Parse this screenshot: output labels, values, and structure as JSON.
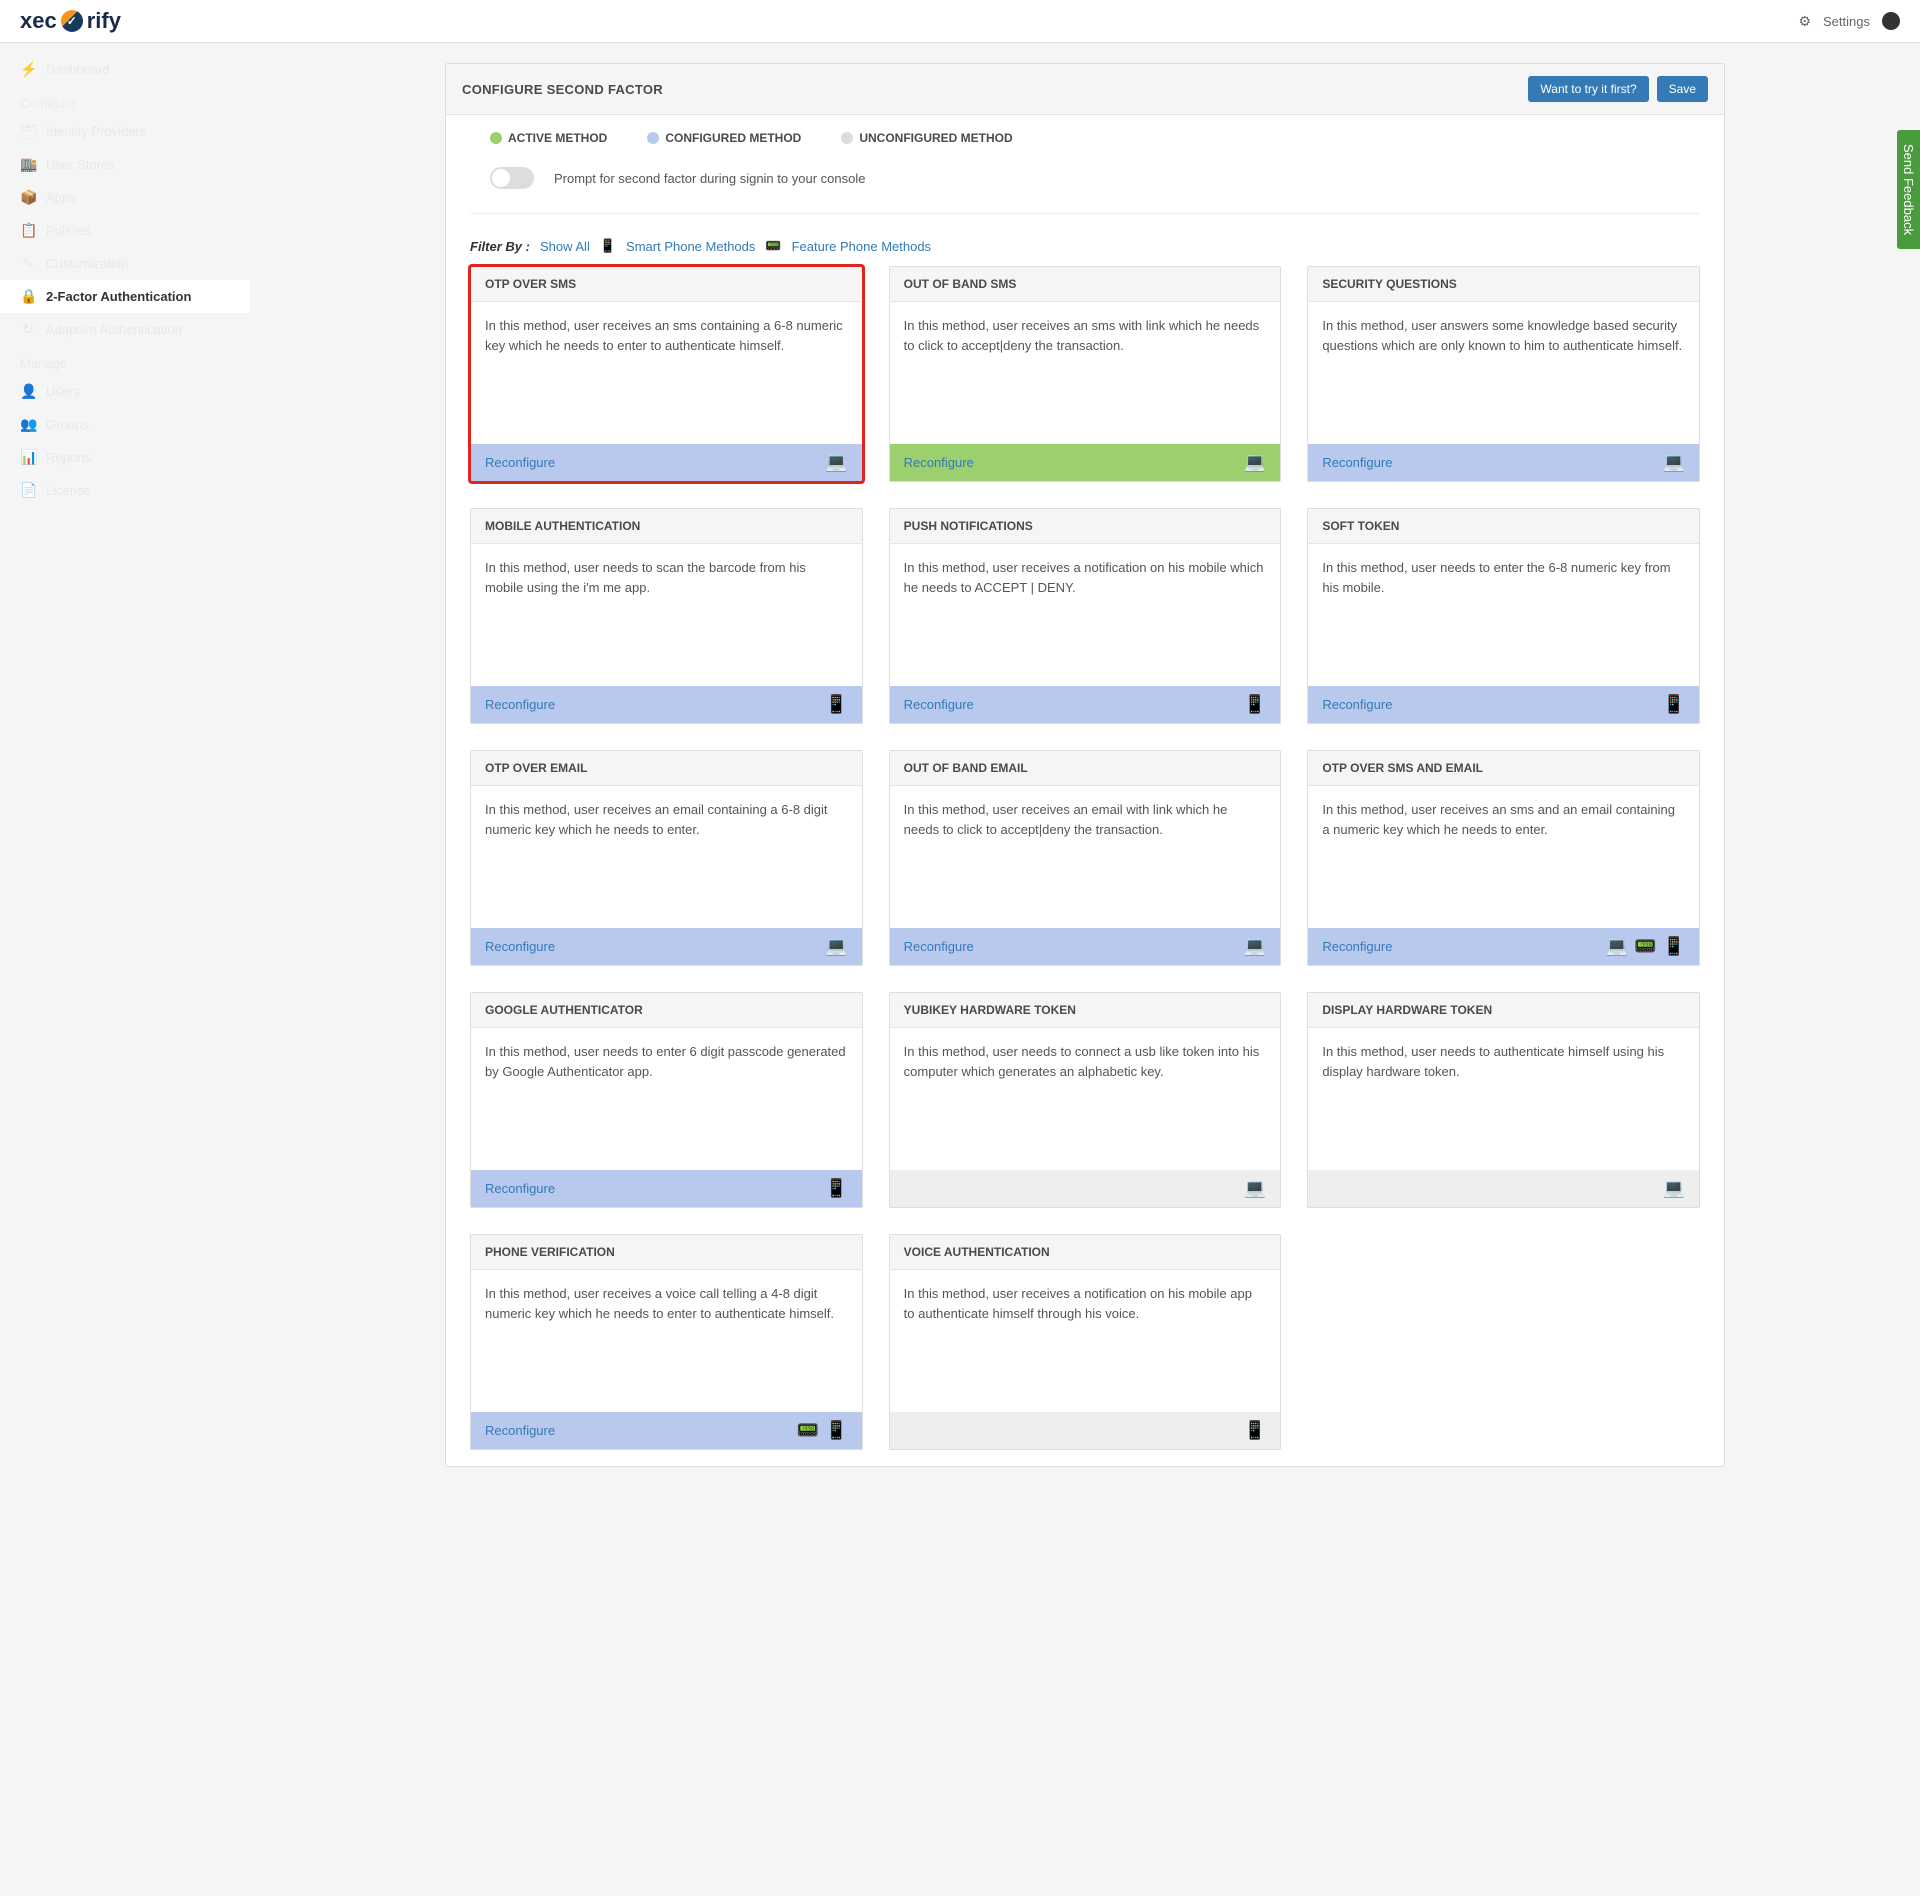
{
  "top": {
    "settings": "Settings"
  },
  "feedback": "Send Feedback",
  "nav": {
    "configure": "Configure",
    "manage": "Manage",
    "items": [
      {
        "icon": "⚡",
        "label": "Dashboard"
      },
      {
        "icon": "🗂",
        "label": "Identity Providers"
      },
      {
        "icon": "🏬",
        "label": "User Stores"
      },
      {
        "icon": "📦",
        "label": "Apps"
      },
      {
        "icon": "📋",
        "label": "Policies"
      },
      {
        "icon": "✎",
        "label": "Customization"
      },
      {
        "icon": "🔒",
        "label": "2-Factor Authentication",
        "active": true
      },
      {
        "icon": "↻",
        "label": "Adaptive Authentication"
      },
      {
        "icon": "👤",
        "label": "Users"
      },
      {
        "icon": "👥",
        "label": "Groups"
      },
      {
        "icon": "📊",
        "label": "Reports"
      },
      {
        "icon": "📄",
        "label": "License"
      }
    ]
  },
  "panel": {
    "title": "CONFIGURE SECOND FACTOR",
    "try": "Want to try it first?",
    "save": "Save",
    "legend": {
      "active": "ACTIVE METHOD",
      "configured": "CONFIGURED METHOD",
      "unconfigured": "UNCONFIGURED METHOD"
    },
    "prompt": "Prompt for second factor during signin to your console",
    "filter": {
      "label": "Filter By :",
      "all": "Show All",
      "smart": "Smart Phone Methods",
      "feature": "Feature Phone Methods"
    }
  },
  "reconfigure": "Reconfigure",
  "cards": [
    {
      "title": "OTP OVER SMS",
      "desc": "In this method, user receives an sms containing a 6-8 numeric key which he needs to enter to authenticate himself.",
      "status": "configured",
      "action": true,
      "icons": [
        "💻"
      ],
      "highlight": true
    },
    {
      "title": "OUT OF BAND SMS",
      "desc": "In this method, user receives an sms with link which he needs to click to accept|deny the transaction.",
      "status": "active",
      "action": true,
      "icons": [
        "💻"
      ]
    },
    {
      "title": "SECURITY QUESTIONS",
      "desc": "In this method, user answers some knowledge based security questions which are only known to him to authenticate himself.",
      "status": "configured",
      "action": true,
      "icons": [
        "💻"
      ]
    },
    {
      "title": "MOBILE AUTHENTICATION",
      "desc": "In this method, user needs to scan the barcode from his mobile using the i'm me app.",
      "status": "configured",
      "action": true,
      "icons": [
        "📱"
      ]
    },
    {
      "title": "PUSH NOTIFICATIONS",
      "desc": "In this method, user receives a notification on his mobile which he needs to ACCEPT | DENY.",
      "status": "configured",
      "action": true,
      "icons": [
        "📱"
      ]
    },
    {
      "title": "SOFT TOKEN",
      "desc": "In this method, user needs to enter the 6-8 numeric key from his mobile.",
      "status": "configured",
      "action": true,
      "icons": [
        "📱"
      ]
    },
    {
      "title": "OTP OVER EMAIL",
      "desc": "In this method, user receives an email containing a 6-8 digit numeric key which he needs to enter.",
      "status": "configured",
      "action": true,
      "icons": [
        "💻"
      ]
    },
    {
      "title": "OUT OF BAND EMAIL",
      "desc": "In this method, user receives an email with link which he needs to click to accept|deny the transaction.",
      "status": "configured",
      "action": true,
      "icons": [
        "💻"
      ]
    },
    {
      "title": "OTP OVER SMS AND EMAIL",
      "desc": "In this method, user receives an sms and an email containing a numeric key which he needs to enter.",
      "status": "configured",
      "action": true,
      "icons": [
        "💻",
        "📟",
        "📱"
      ]
    },
    {
      "title": "GOOGLE AUTHENTICATOR",
      "desc": "In this method, user needs to enter 6 digit passcode generated by Google Authenticator app.",
      "status": "configured",
      "action": true,
      "icons": [
        "📱"
      ]
    },
    {
      "title": "YUBIKEY HARDWARE TOKEN",
      "desc": "In this method, user needs to connect a usb like token into his computer which generates an alphabetic key.",
      "status": "unconfigured",
      "action": false,
      "icons": [
        "💻"
      ]
    },
    {
      "title": "DISPLAY HARDWARE TOKEN",
      "desc": "In this method, user needs to authenticate himself using his display hardware token.",
      "status": "unconfigured",
      "action": false,
      "icons": [
        "💻"
      ]
    },
    {
      "title": "PHONE VERIFICATION",
      "desc": "In this method, user receives a voice call telling a 4-8 digit numeric key which he needs to enter to authenticate himself.",
      "status": "configured",
      "action": true,
      "icons": [
        "📟",
        "📱"
      ]
    },
    {
      "title": "VOICE AUTHENTICATION",
      "desc": "In this method, user receives a notification on his mobile app to authenticate himself through his voice.",
      "status": "unconfigured",
      "action": false,
      "icons": [
        "📱"
      ]
    }
  ]
}
